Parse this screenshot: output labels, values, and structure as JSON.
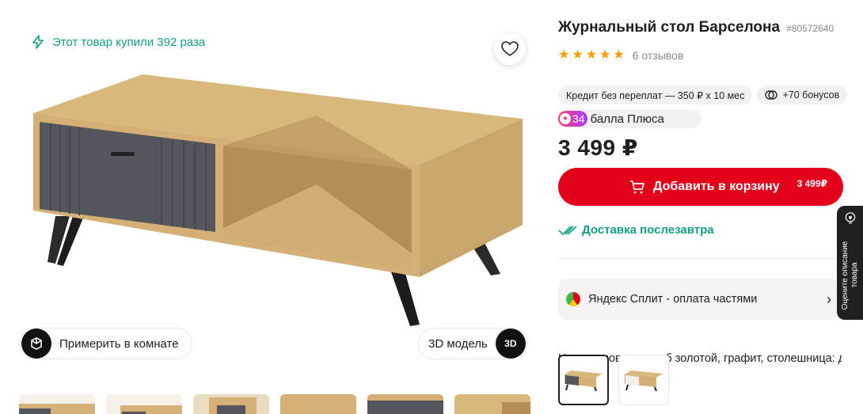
{
  "gallery": {
    "purchased_text": "Этот товар купили 392 раза",
    "try_room_label": "Примерить в комнате",
    "model3d_label": "3D модель",
    "model3d_icon_text": "3D"
  },
  "product": {
    "title": "Журнальный стол Барселона",
    "sku": "#80572640",
    "rating": 5,
    "reviews": "6 отзывов",
    "credit": "Кредит без переплат — 350 ₽ x 10 мес",
    "bonus": "+70 бонусов",
    "plus_points": "34",
    "plus_label": "балла Плюса",
    "price": "3 499 ₽",
    "cart_label": "Добавить в корзину",
    "cart_price": "3 499₽",
    "delivery": "Доставка послезавтра",
    "split_label": "Яндекс Сплит - оплата частями",
    "color_label": "Цвет: основания: дуб золотой, графит, столешница: дуб золотой"
  },
  "side_tab": {
    "label": "Оцените описание товара"
  },
  "colors": {
    "accent_red": "#e3001b",
    "teal": "#129e86",
    "star": "#ff9a00"
  }
}
